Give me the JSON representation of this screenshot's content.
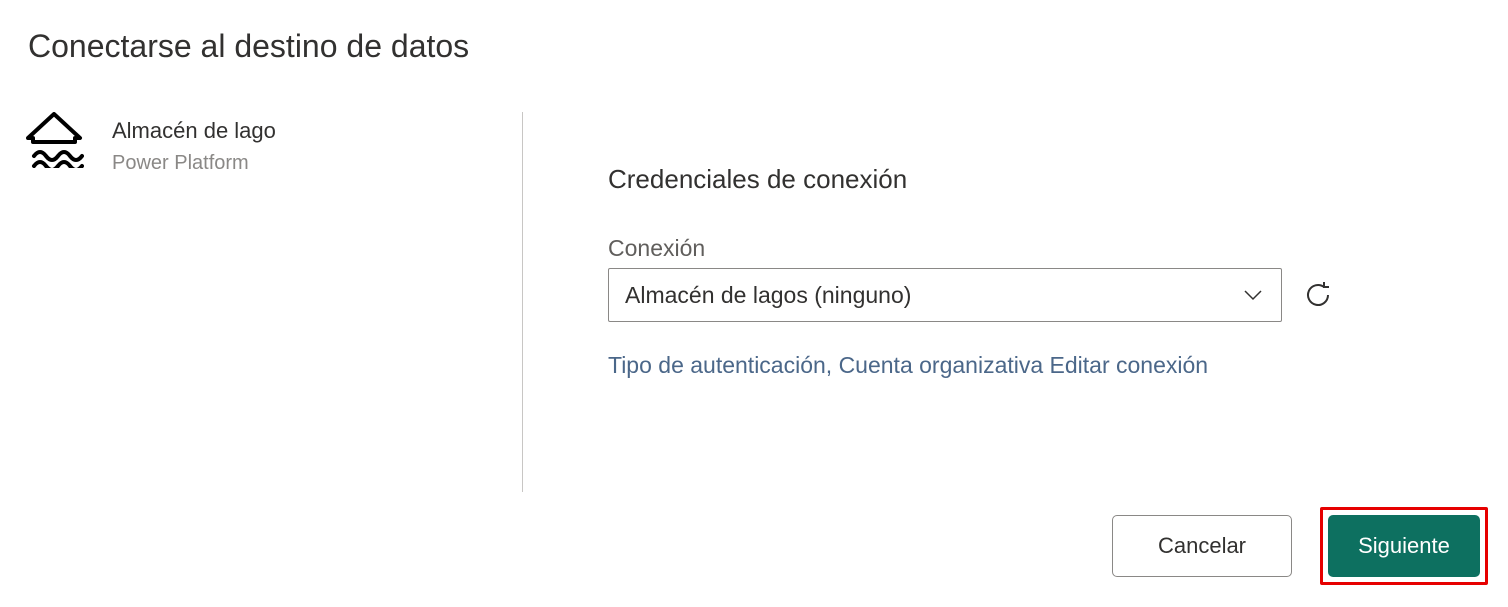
{
  "header": {
    "title": "Conectarse al destino de datos"
  },
  "destination": {
    "name": "Almacén de lago",
    "platform": "Power Platform"
  },
  "credentials": {
    "section_title": "Credenciales de conexión",
    "connection_label": "Conexión",
    "connection_value": "Almacén de lagos (ninguno)",
    "auth_text": "Tipo de autenticación, Cuenta organizativa Editar conexión"
  },
  "footer": {
    "cancel": "Cancelar",
    "next": "Siguiente"
  }
}
